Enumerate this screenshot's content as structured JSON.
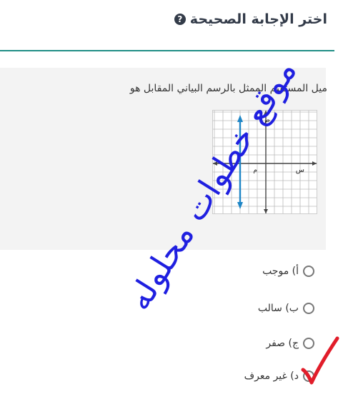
{
  "header": {
    "title": "اختر الإجابة الصحيحة",
    "help_icon": "question-circle-icon",
    "accent_color": "#1f8e85"
  },
  "question": {
    "text": "ميل المستقيم الممثل بالرسم البياني المقابل هو",
    "graph": {
      "y_label": "ص",
      "x_label": "س",
      "origin_label": "م",
      "line": "vertical line with arrows at both ends",
      "line_color": "#1f86c6"
    }
  },
  "options": [
    {
      "label": "أ) موجب"
    },
    {
      "label": "ب) سالب"
    },
    {
      "label": "ج) صفر"
    },
    {
      "label": "د) غير معرف"
    }
  ],
  "overlay": {
    "watermark_text": "موقع خطوات محلوله",
    "watermark_color": "#1f1fe0",
    "checkmark_color": "#e11d2a"
  }
}
